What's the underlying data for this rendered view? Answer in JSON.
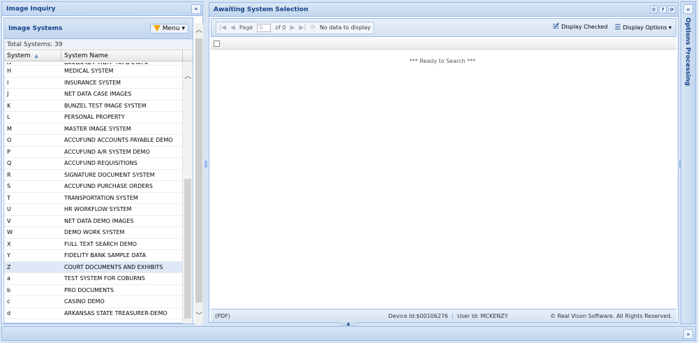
{
  "left_panel": {
    "title": "Image Inquiry",
    "collapse_glyph": "«",
    "systems_panel": {
      "title": "Image Systems",
      "menu_label": "Menu",
      "menu_caret": "▾",
      "total_label": "Total Systems: 39",
      "columns": {
        "system": "System",
        "sort_glyph": "▲",
        "system_name": "System Name"
      },
      "rows": [
        {
          "system": "G",
          "name": "ARKANSAS STATE TREASURER"
        },
        {
          "system": "H",
          "name": "MEDICAL SYSTEM"
        },
        {
          "system": "I",
          "name": "INSURANCE SYSTEM"
        },
        {
          "system": "J",
          "name": "NET DATA CASE IMAGES"
        },
        {
          "system": "K",
          "name": "BUNZEL TEST IMAGE SYSTEM"
        },
        {
          "system": "L",
          "name": "PERSONAL PROPERTY"
        },
        {
          "system": "M",
          "name": "MASTER IMAGE SYSTEM"
        },
        {
          "system": "O",
          "name": "ACCUFUND ACCOUNTS PAYABLE DEMO"
        },
        {
          "system": "P",
          "name": "ACCUFUND A/R SYSTEM DEMO"
        },
        {
          "system": "Q",
          "name": "ACCUFUND REQUISITIONS"
        },
        {
          "system": "R",
          "name": "SIGNATURE DOCUMENT SYSTEM"
        },
        {
          "system": "S",
          "name": "ACCUFUND PURCHASE ORDERS"
        },
        {
          "system": "T",
          "name": "TRANSPORTATION SYSTEM"
        },
        {
          "system": "U",
          "name": "HR WORKFLOW SYSTEM"
        },
        {
          "system": "V",
          "name": "NET DATA DEMO IMAGES"
        },
        {
          "system": "W",
          "name": "DEMO WORK SYSTEM"
        },
        {
          "system": "X",
          "name": "FULL TEXT SEARCH DEMO"
        },
        {
          "system": "Y",
          "name": "FIDELITY BANK SAMPLE DATA"
        },
        {
          "system": "Z",
          "name": "COURT DOCUMENTS AND EXHIBITS"
        },
        {
          "system": "a",
          "name": "TEST SYSTEM FOR COBURNS"
        },
        {
          "system": "b",
          "name": "PRO DOCUMENTS"
        },
        {
          "system": "c",
          "name": "CASINO DEMO"
        },
        {
          "system": "d",
          "name": "ARKANSAS STATE TREASURER-DEMO"
        }
      ],
      "selected_row": "Z"
    }
  },
  "center_panel": {
    "title": "Awaiting System Selection",
    "tool_icons": [
      "gear-icon",
      "help-icon",
      "refresh-icon"
    ],
    "toolbar": {
      "page_label": "Page",
      "page_value": "0",
      "of_label": "of 0",
      "no_data": "No data to display",
      "display_checked": "Display Checked",
      "display_options": "Display Options",
      "caret": "▾"
    },
    "ready_text": "*** Ready to Search ***",
    "footer": {
      "pdf": "(PDF)",
      "device": "Device Id:$00106276",
      "user": "User Id: MCKENZY",
      "copyright": "© Real Vison Software. All Rights Reserved."
    }
  },
  "right_panel": {
    "title": "Options Processing",
    "collapse_glyph": "«"
  },
  "bottom_panel": {
    "expand_glyph": "»",
    "split_glyph": "▲"
  },
  "colors": {
    "header_text": "#15428b",
    "border": "#99bbe8",
    "accent_funnel": "#f2a400"
  }
}
